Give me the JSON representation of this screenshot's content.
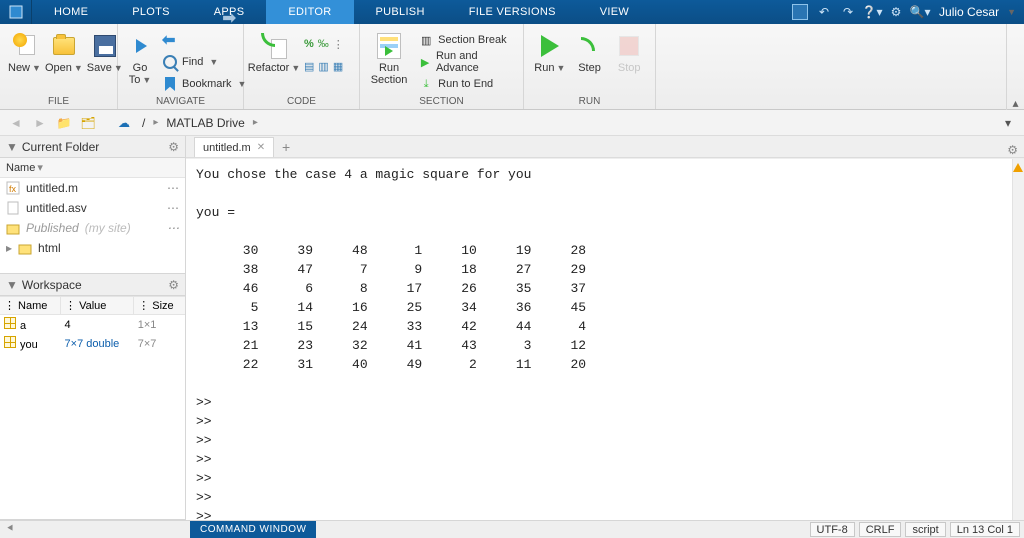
{
  "header": {
    "tabs": [
      "HOME",
      "PLOTS",
      "APPS",
      "EDITOR",
      "PUBLISH",
      "FILE VERSIONS",
      "VIEW"
    ],
    "active_tab_index": 3,
    "user": "Julio Cesar"
  },
  "ribbon": {
    "groups": {
      "file": {
        "label": "FILE",
        "new": "New",
        "open": "Open",
        "save": "Save"
      },
      "navigate": {
        "label": "NAVIGATE",
        "goto": "Go To",
        "find": "Find",
        "bookmark": "Bookmark"
      },
      "code": {
        "label": "CODE",
        "refactor": "Refactor"
      },
      "section": {
        "label": "SECTION",
        "run_section": "Run\nSection",
        "break": "Section Break",
        "run_advance": "Run and Advance",
        "run_end": "Run to End"
      },
      "run": {
        "label": "RUN",
        "run": "Run",
        "step": "Step",
        "stop": "Stop"
      }
    }
  },
  "address": {
    "root": "/",
    "drive": "MATLAB Drive"
  },
  "current_folder": {
    "title": "Current Folder",
    "col": "Name",
    "items": [
      {
        "name": "untitled.m",
        "type": "mfile"
      },
      {
        "name": "untitled.asv",
        "type": "file"
      },
      {
        "name": "Published",
        "note": "(my site)",
        "type": "folder",
        "dim": true
      },
      {
        "name": "html",
        "type": "folder"
      }
    ]
  },
  "workspace": {
    "title": "Workspace",
    "cols": [
      "Name",
      "Value",
      "Size"
    ],
    "vars": [
      {
        "name": "a",
        "value": "4",
        "size": "1×1"
      },
      {
        "name": "you",
        "value": "7×7 double",
        "size": "7×7",
        "link": true
      }
    ]
  },
  "editor": {
    "tab": "untitled.m",
    "output_header": "You chose the case 4 a magic square for you",
    "varname": "you =",
    "matrix": [
      [
        30,
        39,
        48,
        1,
        10,
        19,
        28
      ],
      [
        38,
        47,
        7,
        9,
        18,
        27,
        29
      ],
      [
        46,
        6,
        8,
        17,
        26,
        35,
        37
      ],
      [
        5,
        14,
        16,
        25,
        34,
        36,
        45
      ],
      [
        13,
        15,
        24,
        33,
        42,
        44,
        4
      ],
      [
        21,
        23,
        32,
        41,
        43,
        3,
        12
      ],
      [
        22,
        31,
        40,
        49,
        2,
        11,
        20
      ]
    ],
    "prompt": ">>"
  },
  "status": {
    "cw": "COMMAND WINDOW",
    "encoding": "UTF-8",
    "eol": "CRLF",
    "type": "script",
    "pos": "Ln  13  Col  1"
  }
}
